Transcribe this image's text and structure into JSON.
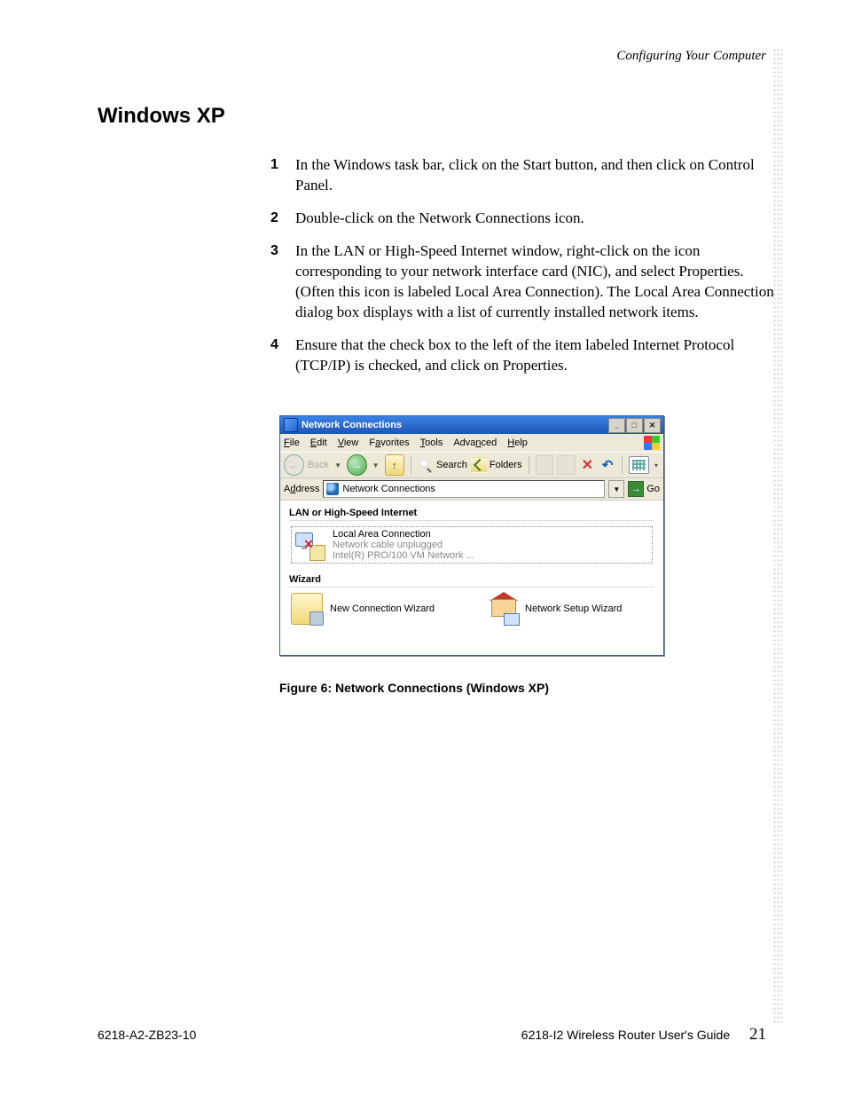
{
  "header": {
    "section": "Configuring Your Computer"
  },
  "title": "Windows XP",
  "steps": [
    {
      "num": "1",
      "text": "In the Windows task bar, click on the Start button, and then click on Control Panel."
    },
    {
      "num": "2",
      "text": "Double-click on the Network Connections icon."
    },
    {
      "num": "3",
      "text": "In the LAN or High-Speed Internet window, right-click on the icon corresponding to your network interface card (NIC), and select Properties. (Often this icon is labeled Local Area Connection). The Local Area Connection dialog box displays with a list of currently installed network items."
    },
    {
      "num": "4",
      "text": "Ensure that the check box to the left of the item labeled Internet Protocol (TCP/IP) is checked, and click on Properties."
    }
  ],
  "xp": {
    "title": "Network Connections",
    "menus": {
      "file": "File",
      "edit": "Edit",
      "view": "View",
      "favorites": "Favorites",
      "tools": "Tools",
      "advanced": "Advanced",
      "help": "Help"
    },
    "toolbar": {
      "back": "Back",
      "search": "Search",
      "folders": "Folders",
      "go": "Go"
    },
    "address": {
      "label": "Address",
      "value": "Network Connections"
    },
    "group1": "LAN or High-Speed Internet",
    "lac": {
      "title": "Local Area Connection",
      "sub1": "Network cable unplugged",
      "sub2": "Intel(R) PRO/100 VM Network ..."
    },
    "group2": "Wizard",
    "wiz1": "New Connection Wizard",
    "wiz2": "Network Setup Wizard"
  },
  "figure_caption": "Figure 6: Network Connections (Windows XP)",
  "footer": {
    "left": "6218-A2-ZB23-10",
    "right": "6218-I2 Wireless Router User's Guide",
    "page": "21"
  }
}
